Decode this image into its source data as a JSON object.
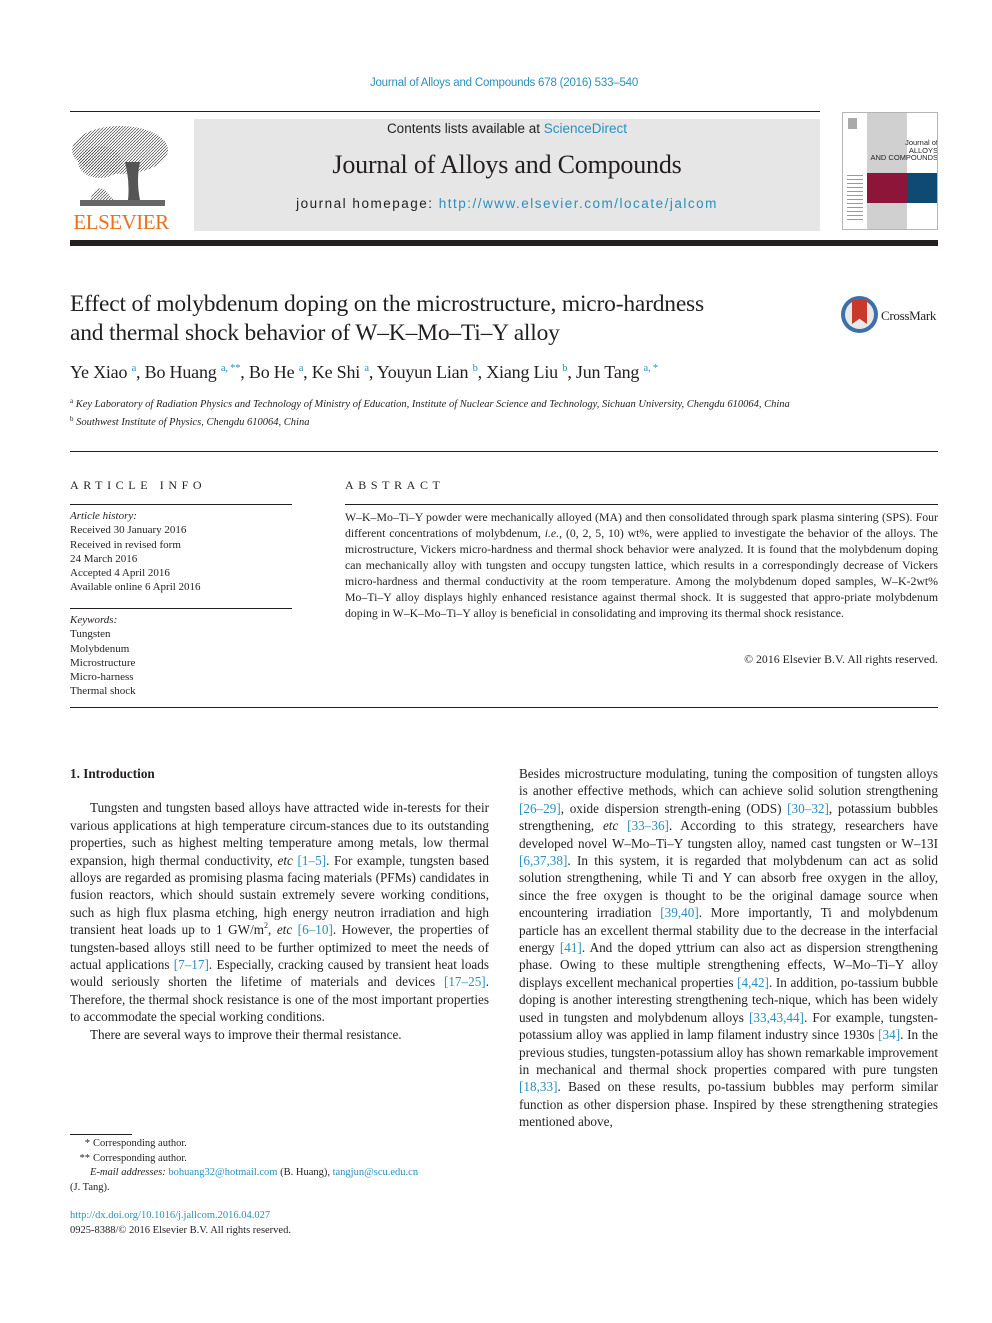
{
  "header": {
    "journal_reference": "Journal of Alloys and Compounds 678 (2016) 533–540",
    "publisher_wordmark": "ELSEVIER",
    "contents_prefix": "Contents lists available at ",
    "contents_link": "ScienceDirect",
    "journal_title": "Journal of Alloys and Compounds",
    "homepage_prefix": "journal homepage: ",
    "homepage_url": "http://www.elsevier.com/locate/jalcom",
    "cover": {
      "title_line1": "Journal of",
      "title_line2": "ALLOYS",
      "title_line3": "AND COMPOUNDS",
      "colors": {
        "maroon": "#8c1539",
        "blue": "#0f4a72",
        "grey": "#d0d0d0"
      }
    },
    "crossmark_label": "CrossMark"
  },
  "article": {
    "title_line1": "Effect of molybdenum doping on the microstructure, micro-hardness",
    "title_line2": "and thermal shock behavior of W–K–Mo–Ti–Y alloy",
    "authors": [
      {
        "name": "Ye Xiao",
        "sup": "a"
      },
      {
        "name": "Bo Huang",
        "sup": "a, **"
      },
      {
        "name": "Bo He",
        "sup": "a"
      },
      {
        "name": "Ke Shi",
        "sup": "a"
      },
      {
        "name": "Youyun Lian",
        "sup": "b"
      },
      {
        "name": "Xiang Liu",
        "sup": "b"
      },
      {
        "name": "Jun Tang",
        "sup": "a, *"
      }
    ],
    "affiliations": [
      {
        "mark": "a",
        "text": "Key Laboratory of Radiation Physics and Technology of Ministry of Education, Institute of Nuclear Science and Technology, Sichuan University, Chengdu 610064, China"
      },
      {
        "mark": "b",
        "text": "Southwest Institute of Physics, Chengdu 610064, China"
      }
    ]
  },
  "article_info": {
    "heading": "ARTICLE INFO",
    "history_heading": "Article history:",
    "history": [
      "Received 30 January 2016",
      "Received in revised form",
      "24 March 2016",
      "Accepted 4 April 2016",
      "Available online 6 April 2016"
    ],
    "keywords_heading": "Keywords:",
    "keywords": [
      "Tungsten",
      "Molybdenum",
      "Microstructure",
      "Micro-harness",
      "Thermal shock"
    ]
  },
  "abstract": {
    "heading": "ABSTRACT",
    "text_part1": "W–K–Mo–Ti–Y powder were mechanically alloyed (MA) and then consolidated through spark plasma sintering (SPS). Four different concentrations of molybdenum, ",
    "text_ie": "i.e.",
    "text_part2": ", (0, 2, 5, 10) wt%, were applied to investigate the behavior of the alloys. The microstructure, Vickers micro-hardness and thermal shock behavior were analyzed. It is found that the molybdenum doping can mechanically alloy with tungsten and occupy tungsten lattice, which results in a correspondingly decrease of Vickers micro-hardness and thermal conductivity at the room temperature. Among the molybdenum doped samples, W–K-2wt% Mo–Ti–Y alloy displays highly enhanced resistance against thermal shock. It is suggested that appro-priate molybdenum doping in W–K–Mo–Ti–Y alloy is beneficial in consolidating and improving its thermal shock resistance.",
    "copyright": "© 2016 Elsevier B.V. All rights reserved."
  },
  "body": {
    "section_heading": "1.  Introduction",
    "left_p1": [
      {
        "t": "Tungsten and tungsten based alloys have attracted wide in-terests for their various applications at high temperature circum-stances due to its outstanding properties, such as highest melting temperature among metals, low thermal expansion, high thermal conductivity, "
      },
      {
        "i": "etc"
      },
      {
        "t": " "
      },
      {
        "r": "[1–5]"
      },
      {
        "t": ". For example, tungsten based alloys are regarded as promising plasma facing materials (PFMs) candidates in fusion reactors, which should sustain extremely severe working conditions, such as high flux plasma etching, high energy neutron irradiation and high transient heat loads up to 1 GW/m"
      },
      {
        "s": "2"
      },
      {
        "t": ", "
      },
      {
        "i": "etc"
      },
      {
        "t": " "
      },
      {
        "r": "[6–10]"
      },
      {
        "t": ". However, the properties of tungsten-based alloys still need to be further optimized to meet the needs of actual applications "
      },
      {
        "r": "[7–17]"
      },
      {
        "t": ". Especially, cracking caused by transient heat loads would seriously shorten the lifetime of materials and devices "
      },
      {
        "r": "[17–25]"
      },
      {
        "t": ". Therefore, the thermal shock resistance is one of the most important properties to accommodate the special working conditions."
      }
    ],
    "left_p2": "There are several ways to improve their thermal resistance.",
    "right_p1": [
      {
        "t": "Besides microstructure modulating, tuning the composition of tungsten alloys is another effective methods, which can achieve solid solution strengthening "
      },
      {
        "r": "[26–29]"
      },
      {
        "t": ", oxide dispersion strength-ening (ODS) "
      },
      {
        "r": "[30–32]"
      },
      {
        "t": ", potassium bubbles strengthening, "
      },
      {
        "i": "etc"
      },
      {
        "t": " "
      },
      {
        "r": "[33–36]"
      },
      {
        "t": ". According to this strategy, researchers have developed novel W–Mo–Ti–Y tungsten alloy, named cast tungsten or W–13I "
      },
      {
        "r": "[6,37,38]"
      },
      {
        "t": ". In this system, it is regarded that molybdenum can act as solid solution strengthening, while Ti and Y can absorb free oxygen in the alloy, since the free oxygen is thought to be the original damage source when encountering irradiation "
      },
      {
        "r": "[39,40]"
      },
      {
        "t": ". More importantly, Ti and molybdenum particle has an excellent thermal stability due to the decrease in the interfacial energy "
      },
      {
        "r": "[41]"
      },
      {
        "t": ". And the doped yttrium can also act as dispersion strengthening phase. Owing to these multiple strengthening effects, W–Mo–Ti–Y alloy displays excellent mechanical properties "
      },
      {
        "r": "[4,42]"
      },
      {
        "t": ". In addition, po-tassium bubble doping is another interesting strengthening tech-nique, which has been widely used in tungsten and molybdenum alloys "
      },
      {
        "r": "[33,43,44]"
      },
      {
        "t": ". For example, tungsten-potassium alloy was applied in lamp filament industry since 1930s "
      },
      {
        "r": "[34]"
      },
      {
        "t": ". In the previous studies, tungsten-potassium alloy has shown remarkable improvement in mechanical and thermal shock properties compared with pure tungsten "
      },
      {
        "r": "[18,33]"
      },
      {
        "t": ". Based on these results, po-tassium bubbles may perform similar function as other dispersion phase. Inspired by these strengthening strategies mentioned above,"
      }
    ]
  },
  "footnotes": {
    "corr1_mark": "*",
    "corr1_text": "Corresponding author.",
    "corr2_mark": "**",
    "corr2_text": "Corresponding author.",
    "email_label": "E-mail addresses:",
    "email1": "bohuang32@hotmail.com",
    "email1_owner": " (B. Huang), ",
    "email2": "tangjun@scu.edu.cn",
    "email2_owner": "(J. Tang).",
    "doi": "http://dx.doi.org/10.1016/j.jallcom.2016.04.027",
    "issn_copyright": "0925-8388/© 2016 Elsevier B.V. All rights reserved."
  },
  "colors": {
    "link": "#2a8fbd",
    "elsevier_orange": "#e9711c",
    "masthead_bg": "#e6e6e6",
    "text": "#231f20"
  }
}
